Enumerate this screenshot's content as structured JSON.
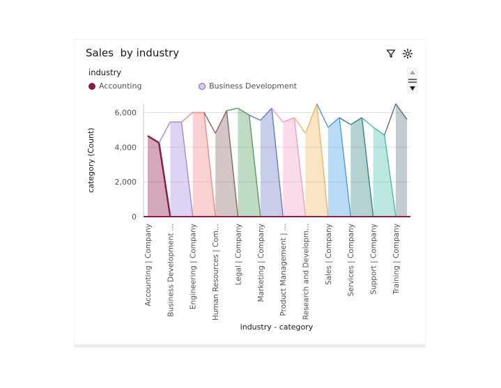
{
  "card": {
    "title": "Sales  by industry"
  },
  "toolbar": {
    "filter_icon": "filter-icon",
    "settings_icon": "settings-icon"
  },
  "legend": {
    "title": "industry",
    "items": [
      {
        "label": "Accounting",
        "color": "#8b1a4a"
      },
      {
        "label": "Business Development",
        "color": "#d6c6f0"
      }
    ]
  },
  "chart_data": {
    "type": "area",
    "xlabel": "industry - category",
    "ylabel": "category (Count)",
    "ylim": [
      0,
      6500
    ],
    "yticks": [
      0,
      2000,
      4000,
      6000
    ],
    "grid": true,
    "legend_position": "top-left",
    "categories": [
      "Accounting | Company",
      "Business Development ...",
      "Engineering | Company",
      "Human Resources | Com...",
      "Legal | Company",
      "Marketing | Company",
      "Product Management | ...",
      "Research and Developm...",
      "Sales | Company",
      "Services | Company",
      "Support | Company",
      "Training | Company"
    ],
    "series": [
      {
        "color": "#8b1a4a",
        "values": [
          4650,
          4250
        ]
      },
      {
        "color": "#a98ce0",
        "values": [
          5450,
          5450
        ]
      },
      {
        "color": "#f58a8a",
        "values": [
          6000,
          6000
        ]
      },
      {
        "color": "#8f6a6a",
        "values": [
          4800,
          6100
        ]
      },
      {
        "color": "#5aa062",
        "values": [
          6250,
          5850
        ]
      },
      {
        "color": "#6f7fc8",
        "values": [
          5550,
          6250
        ]
      },
      {
        "color": "#f2a0c8",
        "values": [
          5450,
          5700
        ]
      },
      {
        "color": "#f0b860",
        "values": [
          4800,
          6500
        ]
      },
      {
        "color": "#4aa0e8",
        "values": [
          5150,
          5700
        ]
      },
      {
        "color": "#3a8a8a",
        "values": [
          5300,
          5700
        ]
      },
      {
        "color": "#4cc0b0",
        "values": [
          5150,
          4700
        ]
      },
      {
        "color": "#5a7a8a",
        "values": [
          6500,
          5600
        ]
      }
    ]
  }
}
